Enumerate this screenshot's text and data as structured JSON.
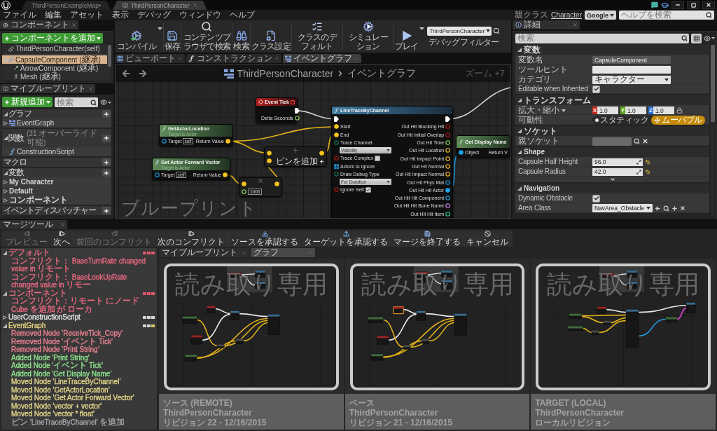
{
  "title_tabs": [
    {
      "label": "ThirdPersonExampleMap•",
      "kind": "map",
      "selected": false
    },
    {
      "label": "ThirdPersonCharacter",
      "kind": "blueprint",
      "selected": true
    }
  ],
  "menu": [
    "ファイル",
    "編集",
    "アセット",
    "表示",
    "デバッグ",
    "ウィンドウ",
    "ヘルプ"
  ],
  "parent_class": {
    "label": "親クラス",
    "value": "Character"
  },
  "help_search": {
    "provider": "Google",
    "placeholder": "ヘルプを検索"
  },
  "components": {
    "tab": "コンポーネント",
    "add_button": "コンポーネントを追加",
    "tree": [
      {
        "label": "ThirdPersonCharacter(self)",
        "kind": "self",
        "selected": false
      },
      {
        "label": "CapsuleComponent (継承)",
        "kind": "capsule",
        "selected": true,
        "expanded": true,
        "children": [
          {
            "label": "ArrowComponent (継承)",
            "kind": "arrow",
            "selected": false
          },
          {
            "label": "Mesh (継承)",
            "kind": "mesh",
            "selected": false
          }
        ]
      }
    ]
  },
  "my_blueprint": {
    "tab": "マイブループリント",
    "add_button": "新規追加",
    "search_placeholder": "検索",
    "sections": [
      {
        "title": "グラフ",
        "expanded": true,
        "items": [
          {
            "label": "EventGraph",
            "kind": "graph",
            "expanded": false
          }
        ]
      },
      {
        "title": "関数",
        "count": "(31 オーバーライド可能)",
        "expanded": true,
        "items": [
          {
            "label": "ConstructionScript",
            "kind": "function"
          }
        ]
      },
      {
        "title": "マクロ"
      },
      {
        "title": "変数",
        "expanded": true,
        "items": [
          {
            "label": "My Character",
            "kind": "category",
            "expanded": false
          },
          {
            "label": "Default",
            "kind": "category",
            "expanded": false
          },
          {
            "label": "コンポーネント",
            "kind": "category",
            "expanded": false
          }
        ]
      },
      {
        "title": "イベントディスパッチャー"
      }
    ]
  },
  "toolbar": [
    {
      "label": "コンパイル",
      "kind": "compile",
      "dropdown": true
    },
    {
      "label": "保存",
      "kind": "save",
      "dropdown": false
    },
    {
      "label": "コンテンツブラウザで検索",
      "kind": "browse",
      "dropdown": false
    },
    {
      "label": "検索",
      "kind": "search",
      "dropdown": false
    },
    {
      "label": "クラス設定",
      "kind": "class_settings",
      "dropdown": false
    },
    {
      "label": "クラスのデフォルト",
      "kind": "class_defaults",
      "dropdown": false
    },
    {
      "label": "シミュレーション",
      "kind": "simulate",
      "dropdown": false
    },
    {
      "label": "プレイ",
      "kind": "play",
      "dropdown": true
    }
  ],
  "debug_filter": {
    "value": "ThirdPersonCharacter",
    "label": "デバッグフィルター"
  },
  "editor_tabs": [
    {
      "label": "ビューポート",
      "kind": "viewport",
      "selected": false
    },
    {
      "label": "コンストラクション",
      "kind": "function",
      "selected": false
    },
    {
      "label": "イベントグラフ",
      "kind": "graph",
      "selected": true
    }
  ],
  "graph": {
    "breadcrumb": {
      "root": "ThirdPersonCharacter",
      "current": "イベントグラフ"
    },
    "zoom": "ズーム +7",
    "watermark": "ブループリント",
    "nodes": [
      {
        "kind": "event",
        "title": "Event Tick",
        "outputs": [
          {
            "kind": "exec",
            "connected": true
          },
          {
            "label": "Delta Seconds",
            "kind": "float",
            "connected": false
          }
        ]
      },
      {
        "kind": "pure",
        "title": "GetActorLocation",
        "subtitle": "Target is Actor",
        "inputs": [
          {
            "label": "Target",
            "kind": "object",
            "connected": false,
            "default": "self"
          }
        ],
        "outputs": [
          {
            "label": "Return Value",
            "kind": "vector",
            "connected": true
          }
        ]
      },
      {
        "kind": "pure",
        "title": "Get Actor Forward Vector",
        "subtitle": "Target is Actor",
        "inputs": [
          {
            "label": "Target",
            "kind": "object",
            "connected": false,
            "default": "self"
          }
        ],
        "outputs": [
          {
            "label": "Return Value",
            "kind": "vector",
            "connected": true
          }
        ]
      },
      {
        "kind": "operator",
        "symbol": "+",
        "inputs": [
          {
            "kind": "vector",
            "connected": true
          },
          {
            "kind": "vector",
            "connected": true
          }
        ],
        "outputs": [
          {
            "kind": "vector",
            "connected": true
          }
        ],
        "add_pin": "ピンを追加"
      },
      {
        "kind": "operator",
        "symbol": "×",
        "inputs": [
          {
            "kind": "vector",
            "connected": true
          },
          {
            "kind": "float",
            "connected": false,
            "value": "1000"
          }
        ],
        "outputs": [
          {
            "kind": "vector",
            "connected": true
          }
        ]
      },
      {
        "kind": "function",
        "title": "LineTraceByChannel",
        "inputs": [
          {
            "kind": "exec",
            "connected": true
          },
          {
            "label": "Start",
            "kind": "vector",
            "connected": true
          },
          {
            "label": "End",
            "kind": "vector",
            "connected": true
          },
          {
            "label": "Trace Channel",
            "kind": "enum",
            "connected": false,
            "dropdown": "Visibility"
          },
          {
            "label": "Trace Complex",
            "kind": "bool",
            "connected": false,
            "checked": false
          },
          {
            "label": "Actors to Ignore",
            "kind": "array",
            "connected": false
          },
          {
            "label": "Draw Debug Type",
            "kind": "enum",
            "connected": false,
            "dropdown": "For Duration"
          },
          {
            "label": "Ignore Self",
            "kind": "bool",
            "connected": false,
            "checked": true
          }
        ],
        "outputs": [
          {
            "kind": "exec",
            "connected": true
          },
          {
            "label": "Out Hit Blocking Hit",
            "kind": "bool",
            "connected": false
          },
          {
            "label": "Out Hit Initial Overlap",
            "kind": "bool",
            "connected": false
          },
          {
            "label": "Out Hit Time",
            "kind": "float",
            "connected": false
          },
          {
            "label": "Out Hit Location",
            "kind": "vector",
            "connected": false
          },
          {
            "label": "Out Hit Impact Point",
            "kind": "vector",
            "connected": false
          },
          {
            "label": "Out Hit Normal",
            "kind": "vector",
            "connected": false
          },
          {
            "label": "Out Hit Impact Normal",
            "kind": "vector",
            "connected": false
          },
          {
            "label": "Out Hit Phys Mat",
            "kind": "object",
            "connected": false
          },
          {
            "label": "Out Hit Hit Actor",
            "kind": "object",
            "connected": true
          },
          {
            "label": "Out Hit Hit Component",
            "kind": "object",
            "connected": false
          },
          {
            "label": "Out Hit Hit Bone Name",
            "kind": "name",
            "connected": false
          },
          {
            "label": "Out Hit Hit Item",
            "kind": "int",
            "connected": false
          }
        ]
      },
      {
        "kind": "pure",
        "title": "Get Display Name",
        "inputs": [
          {
            "label": "Object",
            "kind": "object",
            "connected": true
          }
        ],
        "outputs": [
          {
            "label": "Return V"
          }
        ]
      }
    ]
  },
  "details": {
    "tab": "詳細",
    "search_placeholder": "検索",
    "sections": [
      {
        "title": "変数",
        "expanded": true,
        "rows": [
          {
            "label": "変数名",
            "kind": "text",
            "value": "CapsuleComponent",
            "disabled": true
          },
          {
            "label": "ツールヒント",
            "kind": "text",
            "disabled": false
          },
          {
            "label": "カテゴリ",
            "kind": "combo",
            "value": "キャラクター"
          },
          {
            "label": "Editable when Inherited",
            "kind": "checkbox",
            "checked": true
          }
        ]
      },
      {
        "title": "トランスフォーム",
        "expanded": true,
        "rows": [
          {
            "label": "拡大・縮小",
            "kind": "vector",
            "values": [
              {
                "axis": "X",
                "value": "1.0"
              },
              {
                "axis": "Y",
                "value": "1.0"
              },
              {
                "axis": "Z",
                "value": "1.0"
              }
            ]
          },
          {
            "label": "可動性",
            "kind": "toggle",
            "options": [
              {
                "label": "スタティック",
                "kind": "static",
                "selected": false
              },
              {
                "label": "ムーバブル",
                "kind": "movable",
                "selected": true
              }
            ]
          }
        ]
      },
      {
        "title": "ソケット",
        "expanded": true,
        "rows": [
          {
            "label": "親ソケット",
            "kind": "asset"
          }
        ]
      },
      {
        "title": "Shape",
        "expanded": true,
        "advanced": true,
        "rows": [
          {
            "label": "Capsule Half Height",
            "kind": "number",
            "value": "96.0",
            "modified": true
          },
          {
            "label": "Capsule Radius",
            "kind": "number",
            "value": "42.0",
            "modified": true
          }
        ]
      },
      {
        "title": "Navigation",
        "expanded": true,
        "rows": [
          {
            "label": "Dynamic Obstacle",
            "kind": "checkbox",
            "checked": true
          },
          {
            "label": "Area Class",
            "kind": "class",
            "value": "NavArea_Obstacle"
          }
        ]
      }
    ]
  },
  "merge": {
    "tab": "マージツール",
    "toolbar": [
      {
        "label": "プレビュー",
        "kind": "prev",
        "disabled": true
      },
      {
        "label": "次へ",
        "kind": "next",
        "disabled": false
      },
      {
        "label": "前回のコンフリクト",
        "kind": "prev",
        "disabled": true
      },
      {
        "label": "次のコンフリクト",
        "kind": "next",
        "disabled": false
      },
      {
        "label": "ソースを承認する",
        "kind": "accept_source",
        "disabled": false
      },
      {
        "label": "ターゲットを承認する",
        "kind": "accept_target",
        "disabled": false
      },
      {
        "label": "マージを終了する",
        "kind": "finish",
        "disabled": false
      },
      {
        "label": "キャンセル",
        "kind": "cancel",
        "disabled": false
      }
    ],
    "changes": [
      {
        "label": "デフォルト",
        "color": "#ec6a82",
        "expanded": true,
        "markers": [
          {
            "color": "#e0566c"
          },
          {
            "color": "#e0566c"
          },
          {
            "color": "#e0566c"
          }
        ],
        "children": [
          {
            "label": "コンフリクト： BaseTurnRate changed value in リモート",
            "color": "#ec6a82"
          },
          {
            "label": "コンフリクト： BaseLookUpRate changed value in リモー",
            "color": "#ec6a82"
          }
        ]
      },
      {
        "label": "コンポーネント",
        "color": "#ec6a82",
        "expanded": true,
        "markers": [
          {
            "color": "#e0566c"
          },
          {
            "color": "#e0566c"
          },
          {
            "color": "#e0566c"
          }
        ],
        "children": [
          {
            "label": "コンフリクト：リモート にノード Cube を追加 が ローカ",
            "color": "#ec6a82"
          }
        ]
      },
      {
        "label": "UserConstructionScript",
        "color": "#e4e4e4",
        "expanded": false,
        "markers": [
          {
            "color": "#d8d8d8"
          },
          {
            "color": "#d8d8d8"
          },
          {
            "color": "#d8d8d8"
          }
        ]
      },
      {
        "label": "EventGraph",
        "color": "#e3d27c",
        "expanded": true,
        "markers": [
          {
            "color": "#d8d8d8"
          },
          {
            "color": "#d8d8d8"
          },
          {
            "color": "#d6c35e"
          }
        ],
        "children": [
          {
            "label": "Removed Node 'ReceiveTick_Copy'",
            "color": "#ee8393"
          },
          {
            "label": "Removed Node 'イベント Tick'",
            "color": "#ee8393"
          },
          {
            "label": "Removed Node 'Print String'",
            "color": "#ee8393"
          },
          {
            "label": "Added Node 'Print String'",
            "color": "#8fe68f"
          },
          {
            "label": "Added Node 'イベント Tick'",
            "color": "#8fe68f"
          },
          {
            "label": "Added Node 'Get Display Name'",
            "color": "#8fe68f"
          },
          {
            "label": "Moved Node 'LineTraceByChannel'",
            "color": "#e3d68a"
          },
          {
            "label": "Moved Node 'GetActorLocation'",
            "color": "#e3d68a"
          },
          {
            "label": "Moved Node 'Get Actor Forward Vector'",
            "color": "#e3d68a"
          },
          {
            "label": "Moved Node 'vector + vector'",
            "color": "#e3d68a"
          },
          {
            "label": "Moved Node 'vector * float'",
            "color": "#e3d68a"
          },
          {
            "label": "ピン 'LineTraceByChannel' を追加",
            "color": "#a6a6a6"
          }
        ]
      }
    ],
    "view_tabs": [
      {
        "label": "マイブループリント",
        "selected": false
      },
      {
        "label": "グラフ",
        "selected": true
      }
    ],
    "panels": [
      {
        "kind": "remote",
        "overlay": "読み取り専用",
        "caption": "ソース (REMOTE)",
        "asset": "ThirdPersonCharacter",
        "revision": "リビジョン 22 - 12/16/2015"
      },
      {
        "kind": "base",
        "overlay": "読み取り専用",
        "caption": "ベース",
        "asset": "ThirdPersonCharacter",
        "revision": "リビジョン 21 - 12/16/2015"
      },
      {
        "kind": "local",
        "overlay": "読み取り専用",
        "caption": "TARGET (LOCAL)",
        "asset": "ThirdPersonCharacter",
        "revision": "ローカルリビジョン"
      }
    ]
  }
}
